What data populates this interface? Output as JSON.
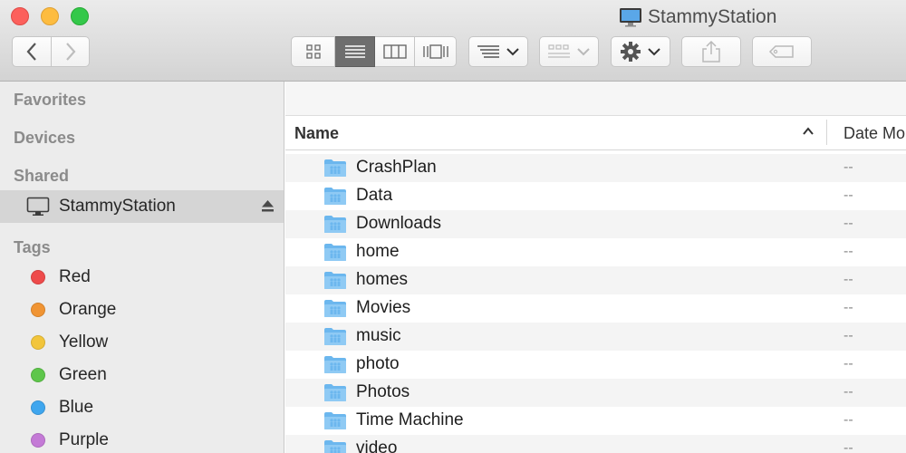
{
  "window": {
    "title": "StammyStation",
    "title_icon": "monitor-icon"
  },
  "toolbar": {
    "back_icon": "chevron-left-icon",
    "forward_icon": "chevron-right-icon",
    "view_modes": [
      "icon-view",
      "list-view",
      "column-view",
      "cover-flow-view"
    ],
    "selected_view": "list-view",
    "arrange_icon": "arrange-icon",
    "group_icon": "group-icon",
    "action_icon": "gear-icon",
    "share_icon": "share-icon",
    "tag_icon": "tag-icon"
  },
  "sidebar": {
    "favorites": "Favorites",
    "devices": "Devices",
    "shared": "Shared",
    "shared_items": [
      {
        "label": "StammyStation",
        "icon": "monitor-icon",
        "selected": true
      }
    ],
    "tags_heading": "Tags",
    "tags": [
      {
        "label": "Red",
        "color": "#ee4b4b"
      },
      {
        "label": "Orange",
        "color": "#f09433"
      },
      {
        "label": "Yellow",
        "color": "#f2c53b"
      },
      {
        "label": "Green",
        "color": "#5ec64b"
      },
      {
        "label": "Blue",
        "color": "#3fa6ee"
      },
      {
        "label": "Purple",
        "color": "#c47ad6"
      }
    ]
  },
  "list": {
    "col_name": "Name",
    "col_date": "Date Mo",
    "sort": "ascending",
    "rows": [
      {
        "name": "CrashPlan",
        "date": "--"
      },
      {
        "name": "Data",
        "date": "--"
      },
      {
        "name": "Downloads",
        "date": "--"
      },
      {
        "name": "home",
        "date": "--"
      },
      {
        "name": "homes",
        "date": "--"
      },
      {
        "name": "Movies",
        "date": "--"
      },
      {
        "name": "music",
        "date": "--"
      },
      {
        "name": "photo",
        "date": "--"
      },
      {
        "name": "Photos",
        "date": "--"
      },
      {
        "name": "Time Machine",
        "date": "--"
      },
      {
        "name": "video",
        "date": "--"
      }
    ]
  },
  "colors": {
    "folder": "#6cb7ee",
    "selection": "#d5d5d5"
  }
}
